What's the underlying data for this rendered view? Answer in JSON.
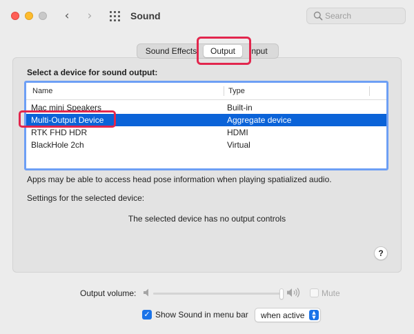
{
  "window": {
    "title": "Sound",
    "search": {
      "placeholder": "Search",
      "value": ""
    }
  },
  "tabs": [
    {
      "label": "Sound Effects",
      "selected": false
    },
    {
      "label": "Output",
      "selected": true
    },
    {
      "label": "Input",
      "selected": false
    }
  ],
  "output": {
    "section_label": "Select a device for sound output:",
    "columns": [
      "Name",
      "Type"
    ],
    "devices": [
      {
        "name": "Mac mini Speakers",
        "type": "Built-in",
        "selected": false
      },
      {
        "name": "Multi-Output Device",
        "type": "Aggregate device",
        "selected": true
      },
      {
        "name": "RTK FHD HDR",
        "type": "HDMI",
        "selected": false
      },
      {
        "name": "BlackHole 2ch",
        "type": "Virtual",
        "selected": false
      }
    ],
    "note": "Apps may be able to access head pose information when playing spatialized audio.",
    "settings_label": "Settings for the selected device:",
    "no_controls": "The selected device has no output controls",
    "help": "?"
  },
  "volume": {
    "label": "Output volume:",
    "level": 1.0,
    "mute_label": "Mute",
    "mute_checked": false,
    "mute_enabled": false
  },
  "menu_bar": {
    "label": "Show Sound in menu bar",
    "checked": true,
    "option": "when active"
  },
  "colors": {
    "selection": "#0b63d8",
    "highlight": "#e2264d",
    "table_focus": "#6d9ff5",
    "accent": "#1a73e8"
  },
  "icons": [
    "back-chevron-icon",
    "forward-chevron-icon",
    "grid-icon",
    "search-icon",
    "speaker-low-icon",
    "speaker-high-icon",
    "checkmark-icon",
    "updown-arrows-icon"
  ]
}
